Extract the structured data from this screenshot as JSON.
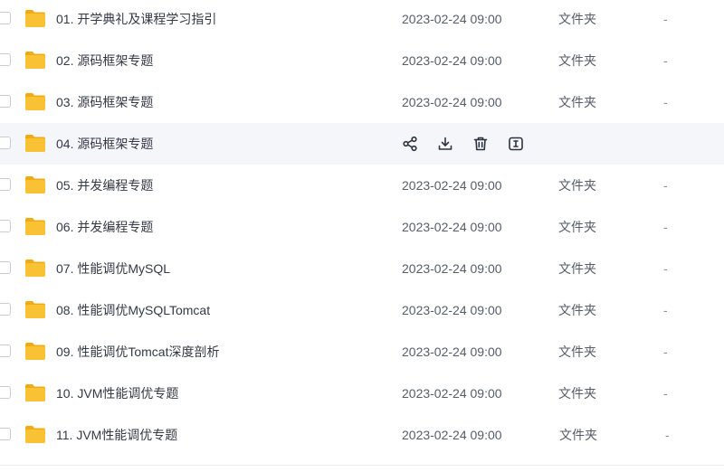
{
  "files": [
    {
      "name": "01. 开学典礼及课程学习指引",
      "date": "2023-02-24 09:00",
      "type": "文件夹",
      "size": "-"
    },
    {
      "name": "02. 源码框架专题",
      "date": "2023-02-24 09:00",
      "type": "文件夹",
      "size": "-"
    },
    {
      "name": "03. 源码框架专题",
      "date": "2023-02-24 09:00",
      "type": "文件夹",
      "size": "-"
    },
    {
      "name": "04. 源码框架专题",
      "date": "",
      "type": "",
      "size": ""
    },
    {
      "name": "05. 并发编程专题",
      "date": "2023-02-24 09:00",
      "type": "文件夹",
      "size": "-"
    },
    {
      "name": "06. 并发编程专题",
      "date": "2023-02-24 09:00",
      "type": "文件夹",
      "size": "-"
    },
    {
      "name": "07. 性能调优MySQL",
      "date": "2023-02-24 09:00",
      "type": "文件夹",
      "size": "-"
    },
    {
      "name": "08. 性能调优MySQLTomcat",
      "date": "2023-02-24 09:00",
      "type": "文件夹",
      "size": "-"
    },
    {
      "name": "09. 性能调优Tomcat深度剖析",
      "date": "2023-02-24 09:00",
      "type": "文件夹",
      "size": "-"
    },
    {
      "name": "10. JVM性能调优专题",
      "date": "2023-02-24 09:00",
      "type": "文件夹",
      "size": "-"
    },
    {
      "name": "11. JVM性能调优专题",
      "date": "2023-02-24 09:00",
      "type": "文件夹",
      "size": "-"
    }
  ],
  "hover_actions": [
    "share-icon",
    "download-icon",
    "delete-icon",
    "rename-icon"
  ],
  "colors": {
    "folder": "#f9c234",
    "folder_dark": "#f0ab13",
    "hover_bg": "#f5f6fa",
    "text": "#333a45",
    "muted": "#555d69"
  }
}
